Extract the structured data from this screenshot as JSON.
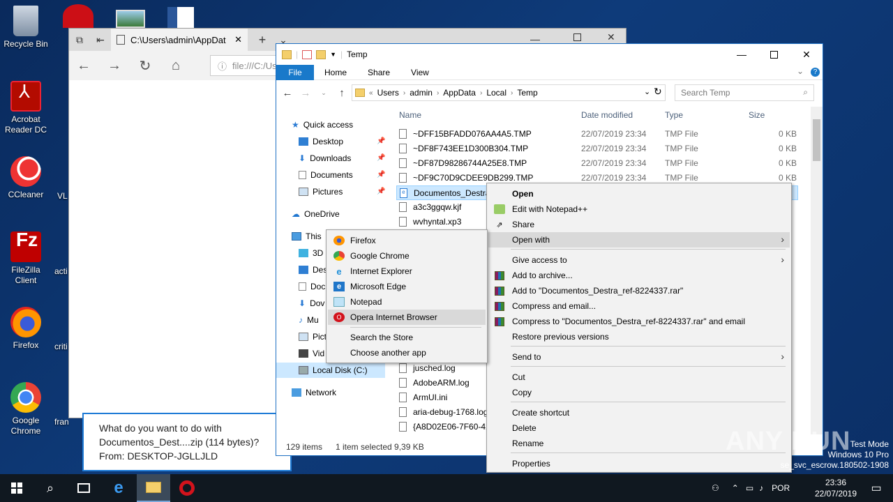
{
  "desktop": {
    "icons": [
      {
        "label": "Recycle Bin"
      },
      {
        "label": "Acrobat Reader DC"
      },
      {
        "label": "CCleaner"
      },
      {
        "label": "FileZilla Client"
      },
      {
        "label": "Firefox"
      },
      {
        "label": "Google Chrome"
      }
    ],
    "partials": [
      "VL",
      "acti",
      "criti",
      "fran"
    ]
  },
  "edge": {
    "tab_title": "C:\\Users\\admin\\AppDat",
    "address": "file:///C:/Us"
  },
  "toast": {
    "line1": "What do you want to do with",
    "line2": "Documentos_Dest....zip (114 bytes)?",
    "line3": "From: DESKTOP-JGLLJLD"
  },
  "explorer": {
    "title": "Temp",
    "ribbon": {
      "file": "File",
      "tabs": [
        "Home",
        "Share",
        "View"
      ]
    },
    "breadcrumb": [
      "Users",
      "admin",
      "AppData",
      "Local",
      "Temp"
    ],
    "search_placeholder": "Search Temp",
    "nav": {
      "quick_access": "Quick access",
      "desktop": "Desktop",
      "downloads": "Downloads",
      "documents": "Documents",
      "pictures": "Pictures",
      "onedrive": "OneDrive",
      "this_pc": "This",
      "objects3d": "3D",
      "desktop2": "Des",
      "documents2": "Doc",
      "downloads2": "Dov",
      "music": "Mu",
      "pictures2": "Pict",
      "videos": "Vid",
      "local_disk": "Local Disk (C:)",
      "network": "Network"
    },
    "columns": {
      "name": "Name",
      "date": "Date modified",
      "type": "Type",
      "size": "Size"
    },
    "files": [
      {
        "name": "~DFF15BFADD076AA4A5.TMP",
        "date": "22/07/2019 23:34",
        "type": "TMP File",
        "size": "0 KB"
      },
      {
        "name": "~DF8F743EE1D300B304.TMP",
        "date": "22/07/2019 23:34",
        "type": "TMP File",
        "size": "0 KB"
      },
      {
        "name": "~DF87D98286744A25E8.TMP",
        "date": "22/07/2019 23:34",
        "type": "TMP File",
        "size": "0 KB"
      },
      {
        "name": "~DF9C70D9CDEE9DB299.TMP",
        "date": "22/07/2019 23:34",
        "type": "TMP File",
        "size": "0 KB"
      },
      {
        "name": "Documentos_Destra"
      },
      {
        "name": "a3c3ggqw.kjf"
      },
      {
        "name": "wvhyntal.xp3"
      }
    ],
    "files_lower": [
      "jusched.log",
      "AdobeARM.log",
      "ArmUI.ini",
      "aria-debug-1768.log",
      "{A8D02E06-7F60-42"
    ],
    "status": {
      "count": "129 items",
      "selected": "1 item selected  9,39 KB"
    }
  },
  "context_menu": {
    "items": [
      "Open",
      "Edit with Notepad++",
      "Share",
      "Open with",
      "Give access to",
      "Add to archive...",
      "Add to \"Documentos_Destra_ref-8224337.rar\"",
      "Compress and email...",
      "Compress to \"Documentos_Destra_ref-8224337.rar\" and email",
      "Restore previous versions",
      "Send to",
      "Cut",
      "Copy",
      "Create shortcut",
      "Delete",
      "Rename",
      "Properties"
    ]
  },
  "open_with": {
    "items": [
      "Firefox",
      "Google Chrome",
      "Internet Explorer",
      "Microsoft Edge",
      "Notepad",
      "Opera Internet Browser",
      "Search the Store",
      "Choose another app"
    ]
  },
  "taskbar": {
    "language": "POR",
    "time": "23:36",
    "date": "22/07/2019"
  },
  "watermark": "ANY RUN",
  "test_mode": {
    "line1": "Test Mode",
    "line2": "Windows 10 Pro",
    "line3": "se_svc_escrow.180502-1908"
  },
  "colors": {
    "accent": "#1979ca",
    "selection": "#cce8ff",
    "menu_bg": "#f2f2f2",
    "taskbar": "#101820"
  }
}
